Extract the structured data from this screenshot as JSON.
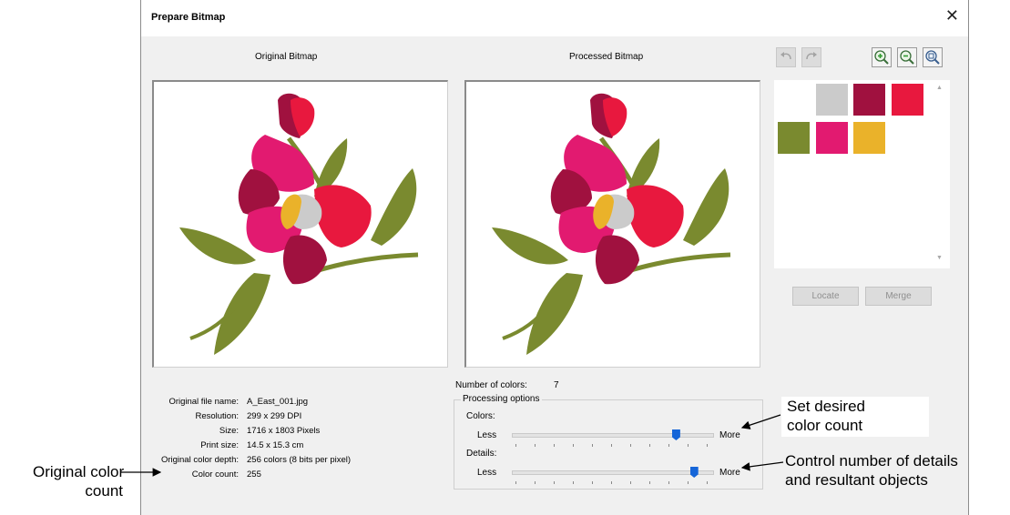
{
  "dialog": {
    "title": "Prepare Bitmap",
    "close_glyph": "✕"
  },
  "original": {
    "heading": "Original Bitmap"
  },
  "processed": {
    "heading": "Processed Bitmap"
  },
  "toolbar": {
    "undo_icon": "undo-icon",
    "redo_icon": "redo-icon",
    "zoom_in_icon": "zoom-in-icon",
    "zoom_out_icon": "zoom-out-icon",
    "zoom_fit_icon": "zoom-fit-icon"
  },
  "palette": {
    "swatches": [
      {
        "color": "#ffffff"
      },
      {
        "color": "#cbcbcb"
      },
      {
        "color": "#a0113f"
      },
      {
        "color": "#e8183e"
      },
      {
        "color": "#7a8a2f"
      },
      {
        "color": "#e21a70"
      },
      {
        "color": "#eab22a"
      }
    ]
  },
  "buttons": {
    "locate": "Locate",
    "merge": "Merge"
  },
  "info": {
    "file_name_label": "Original file name:",
    "file_name": "A_East_001.jpg",
    "resolution_label": "Resolution:",
    "resolution": "299 x 299 DPI",
    "size_label": "Size:",
    "size": "1716 x 1803 Pixels",
    "print_size_label": "Print size:",
    "print_size": "14.5 x 15.3 cm",
    "color_depth_label": "Original color depth:",
    "color_depth": "256 colors (8 bits per pixel)",
    "color_count_label": "Color count:",
    "color_count": "255"
  },
  "colors_count": {
    "label": "Number of colors:",
    "value": "7"
  },
  "processing": {
    "legend": "Processing options",
    "colors_label": "Colors:",
    "details_label": "Details:",
    "less": "Less",
    "more": "More",
    "colors_level": 0.82,
    "details_level": 0.91
  },
  "callouts": {
    "set_color_line1": "Set desired",
    "set_color_line2": "color count",
    "details_line1": "Control number of details",
    "details_line2": "and resultant objects",
    "orig_line1": "Original color",
    "orig_line2": "count"
  }
}
